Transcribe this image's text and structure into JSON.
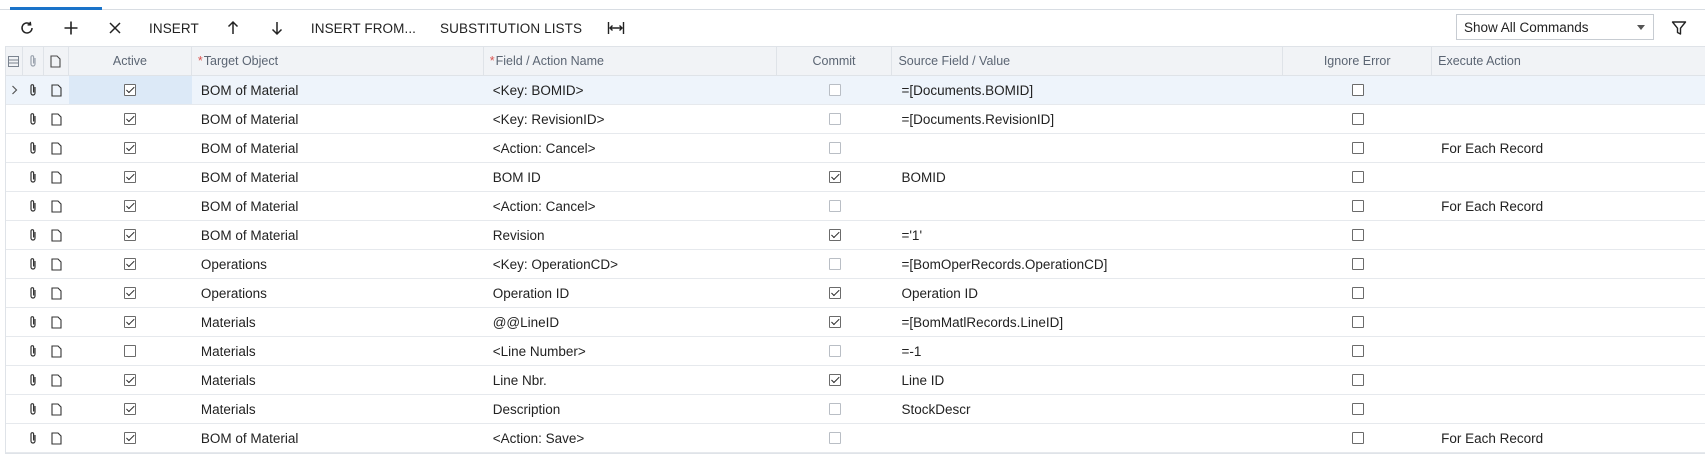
{
  "toolbar": {
    "refresh_icon": "refresh-icon",
    "add_icon": "plus-icon",
    "delete_icon": "close-icon",
    "insert_label": "INSERT",
    "move_up_icon": "arrow-up-icon",
    "move_down_icon": "arrow-down-icon",
    "insert_from_label": "INSERT FROM...",
    "substitution_lists_label": "SUBSTITUTION LISTS",
    "fit_columns_icon": "fit-columns-icon",
    "command_filter_value": "Show All Commands",
    "filter_icon": "filter-icon"
  },
  "grid": {
    "headers": {
      "active": "Active",
      "target_object": "Target Object",
      "field_action_name": "Field / Action Name",
      "commit": "Commit",
      "source_field_value": "Source Field / Value",
      "ignore_error": "Ignore Error",
      "execute_action": "Execute Action"
    },
    "rows": [
      {
        "active": true,
        "target": "BOM of Material",
        "field": "<Key: BOMID>",
        "commit": false,
        "source": "=[Documents.BOMID]",
        "ignore": false,
        "execute": ""
      },
      {
        "active": true,
        "target": "BOM of Material",
        "field": "<Key: RevisionID>",
        "commit": false,
        "source": "=[Documents.RevisionID]",
        "ignore": false,
        "execute": ""
      },
      {
        "active": true,
        "target": "BOM of Material",
        "field": "<Action: Cancel>",
        "commit": false,
        "source": "",
        "ignore": false,
        "execute": "For Each Record"
      },
      {
        "active": true,
        "target": "BOM of Material",
        "field": "BOM ID",
        "commit": true,
        "source": "BOMID",
        "ignore": false,
        "execute": ""
      },
      {
        "active": true,
        "target": "BOM of Material",
        "field": "<Action: Cancel>",
        "commit": false,
        "source": "",
        "ignore": false,
        "execute": "For Each Record"
      },
      {
        "active": true,
        "target": "BOM of Material",
        "field": "Revision",
        "commit": true,
        "source": "='1'",
        "ignore": false,
        "execute": ""
      },
      {
        "active": true,
        "target": "Operations",
        "field": "<Key: OperationCD>",
        "commit": false,
        "source": "=[BomOperRecords.OperationCD]",
        "ignore": false,
        "execute": ""
      },
      {
        "active": true,
        "target": "Operations",
        "field": "Operation ID",
        "commit": true,
        "source": "Operation ID",
        "ignore": false,
        "execute": ""
      },
      {
        "active": true,
        "target": "Materials",
        "field": "@@LineID",
        "commit": true,
        "source": "=[BomMatlRecords.LineID]",
        "ignore": false,
        "execute": ""
      },
      {
        "active": false,
        "target": "Materials",
        "field": "<Line Number>",
        "commit": false,
        "source": "=-1",
        "ignore": false,
        "execute": ""
      },
      {
        "active": true,
        "target": "Materials",
        "field": "Line Nbr.",
        "commit": true,
        "source": "Line ID",
        "ignore": false,
        "execute": ""
      },
      {
        "active": true,
        "target": "Materials",
        "field": "Description",
        "commit": false,
        "source": "StockDescr",
        "ignore": false,
        "execute": ""
      },
      {
        "active": true,
        "target": "BOM of Material",
        "field": "<Action: Save>",
        "commit": false,
        "source": "",
        "ignore": false,
        "execute": "For Each Record"
      }
    ]
  }
}
